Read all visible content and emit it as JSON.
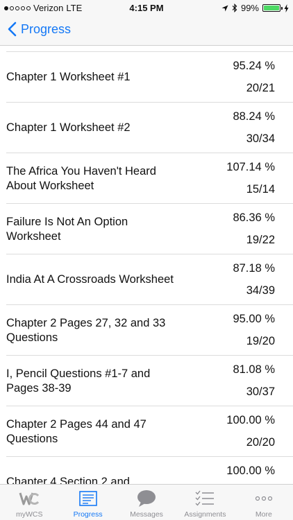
{
  "status_bar": {
    "carrier": "Verizon",
    "network": "LTE",
    "time": "4:15 PM",
    "battery": "99%",
    "battery_level": 0.99
  },
  "nav": {
    "back_label": "Progress"
  },
  "rows": [
    {
      "title": "",
      "percent": "",
      "score": ""
    },
    {
      "title": "Chapter 1 Worksheet #1",
      "percent": "95.24 %",
      "score": "20/21"
    },
    {
      "title": "Chapter 1 Worksheet #2",
      "percent": "88.24 %",
      "score": "30/34"
    },
    {
      "title": "The Africa You Haven't Heard About Worksheet",
      "percent": "107.14 %",
      "score": "15/14"
    },
    {
      "title": "Failure Is Not An Option Worksheet",
      "percent": "86.36 %",
      "score": "19/22"
    },
    {
      "title": "India At A Crossroads Worksheet",
      "percent": "87.18 %",
      "score": "34/39"
    },
    {
      "title": "Chapter 2 Pages 27, 32 and 33 Questions",
      "percent": "95.00 %",
      "score": "19/20"
    },
    {
      "title": "I, Pencil Questions #1-7 and Pages 38-39",
      "percent": "81.08 %",
      "score": "30/37"
    },
    {
      "title": "Chapter 2 Pages 44 and 47 Questions",
      "percent": "100.00 %",
      "score": "20/20"
    },
    {
      "title": "Chapter 4 Section 2 and",
      "percent": "100.00 %",
      "score": ""
    }
  ],
  "tabs": [
    {
      "label": "myWCS",
      "icon": "wcs-logo-icon"
    },
    {
      "label": "Progress",
      "icon": "progress-report-icon"
    },
    {
      "label": "Messages",
      "icon": "speech-bubble-icon"
    },
    {
      "label": "Assignments",
      "icon": "checklist-icon"
    },
    {
      "label": "More",
      "icon": "more-dots-icon"
    }
  ],
  "colors": {
    "accent": "#1478f6",
    "inactive": "#8e8e93",
    "battery": "#4cd964"
  }
}
